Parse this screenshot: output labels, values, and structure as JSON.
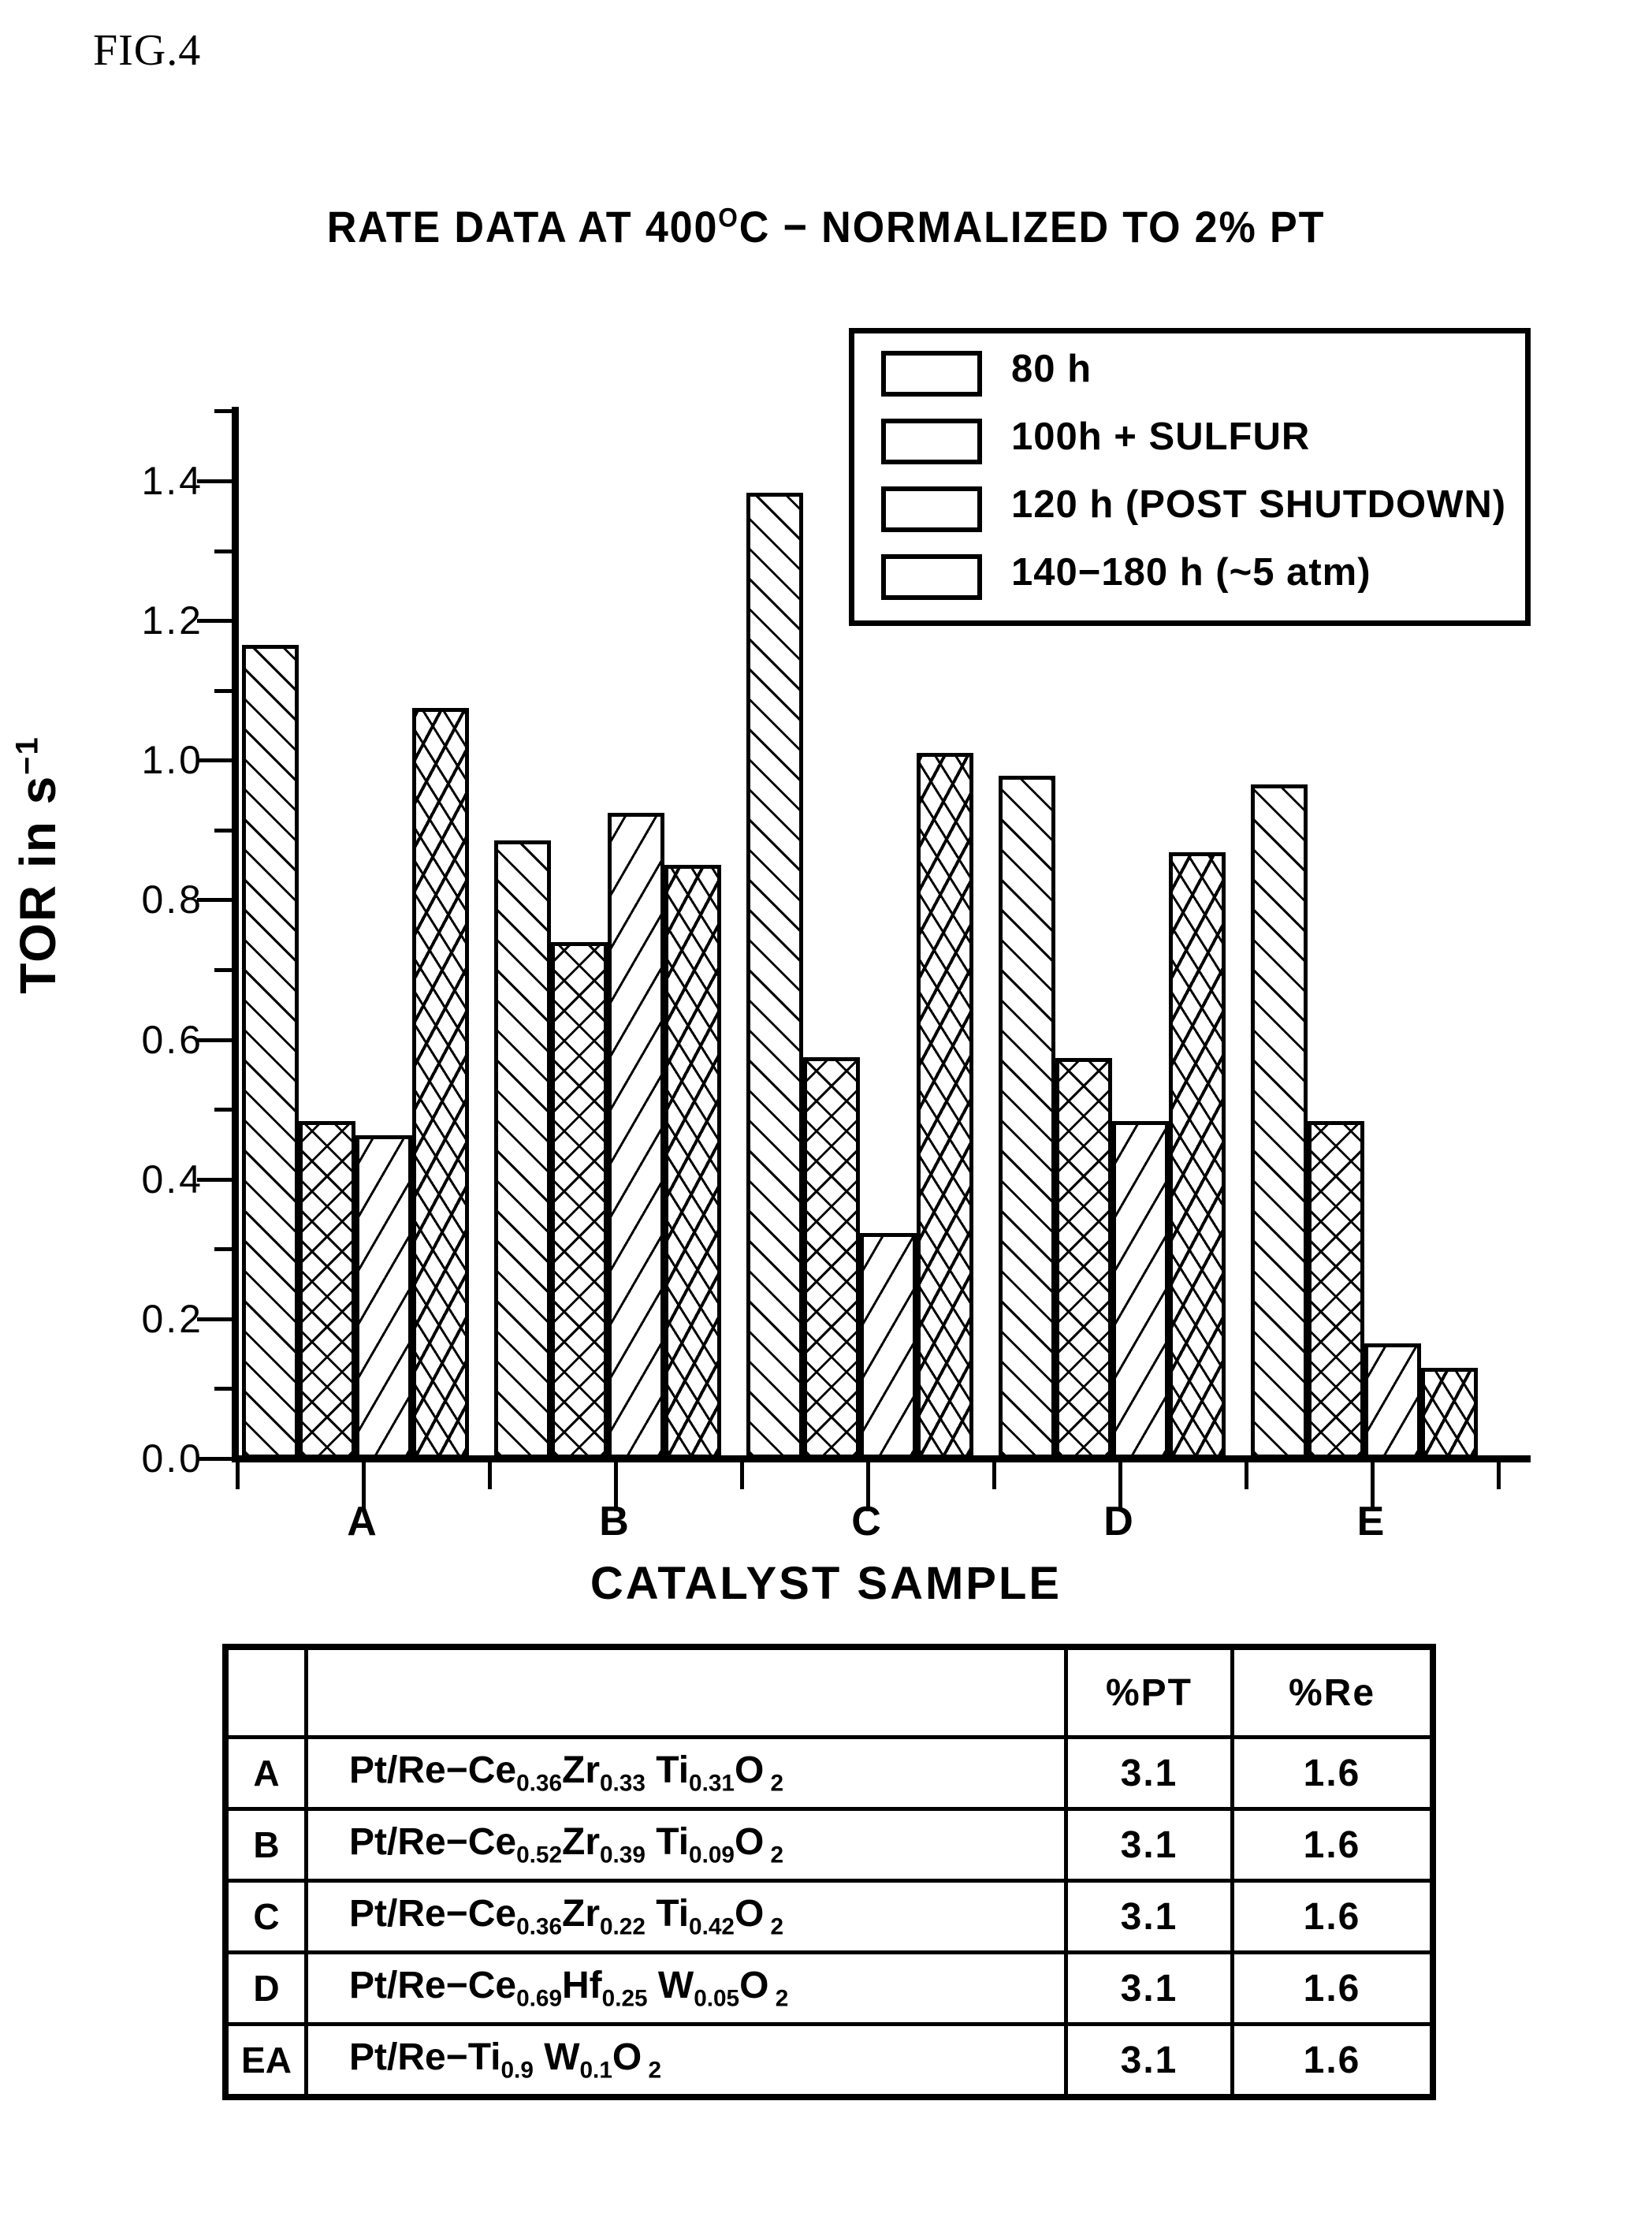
{
  "figure": {
    "label": "FIG.4"
  },
  "chart": {
    "title_main": "RATE DATA AT 400",
    "title_deg": "O",
    "title_rest": "C − NORMALIZED TO 2% PT",
    "y_axis_title_a": "TOR in s",
    "y_axis_title_sup": "−1",
    "x_axis_title": "CATALYST SAMPLE"
  },
  "legend": {
    "items": [
      {
        "label": "80 h",
        "pattern": "p0"
      },
      {
        "label": "100h + SULFUR",
        "pattern": "p1"
      },
      {
        "label": "120 h (POST SHUTDOWN)",
        "pattern": "p2"
      },
      {
        "label": "140−180 h (~5 atm)",
        "pattern": "p3"
      }
    ]
  },
  "chart_data": {
    "type": "bar",
    "title": "RATE DATA AT 400 °C − NORMALIZED TO 2% PT",
    "xlabel": "CATALYST SAMPLE",
    "ylabel": "TOR in s⁻¹",
    "ylim": [
      0.0,
      1.5
    ],
    "yticks": [
      "0.0",
      "0.2",
      "0.4",
      "0.6",
      "0.8",
      "1.0",
      "1.2",
      "1.4"
    ],
    "ytick_values": [
      0.0,
      0.2,
      0.4,
      0.6,
      0.8,
      1.0,
      1.2,
      1.4
    ],
    "minor_tick_step": 0.1,
    "grid": false,
    "legend_position": "upper right",
    "categories": [
      "A",
      "B",
      "C",
      "D",
      "E"
    ],
    "series": [
      {
        "name": "80 h",
        "values": [
          1.165,
          0.885,
          1.383,
          0.978,
          0.965
        ]
      },
      {
        "name": "100h + SULFUR",
        "values": [
          0.483,
          0.74,
          0.575,
          0.573,
          0.483
        ]
      },
      {
        "name": "120 h (POST SHUTDOWN)",
        "values": [
          0.463,
          0.925,
          0.323,
          0.483,
          0.165
        ]
      },
      {
        "name": "140−180 h (~5 atm)",
        "values": [
          1.075,
          0.85,
          1.01,
          0.868,
          0.13
        ]
      }
    ]
  },
  "table": {
    "headers": [
      "",
      "",
      "%PT",
      "%Re"
    ],
    "rows": [
      {
        "id": "A",
        "formula_html": "Pt/Re−Ce<sub>0.36</sub>Zr<sub>0.33</sub> Ti<sub>0.31</sub>O<sub> 2</sub>",
        "pt": "3.1",
        "re": "1.6"
      },
      {
        "id": "B",
        "formula_html": "Pt/Re−Ce<sub>0.52</sub>Zr<sub>0.39</sub> Ti<sub>0.09</sub>O<sub> 2</sub>",
        "pt": "3.1",
        "re": "1.6"
      },
      {
        "id": "C",
        "formula_html": "Pt/Re−Ce<sub>0.36</sub>Zr<sub>0.22</sub> Ti<sub>0.42</sub>O<sub> 2</sub>",
        "pt": "3.1",
        "re": "1.6"
      },
      {
        "id": "D",
        "formula_html": "Pt/Re−Ce<sub>0.69</sub>Hf<sub>0.25</sub> W<sub>0.05</sub>O<sub> 2</sub>",
        "pt": "3.1",
        "re": "1.6"
      },
      {
        "id": "EA",
        "formula_html": "Pt/Re−Ti<sub>0.9</sub> W<sub>0.1</sub>O<sub> 2</sub>",
        "pt": "3.1",
        "re": "1.6"
      }
    ]
  }
}
